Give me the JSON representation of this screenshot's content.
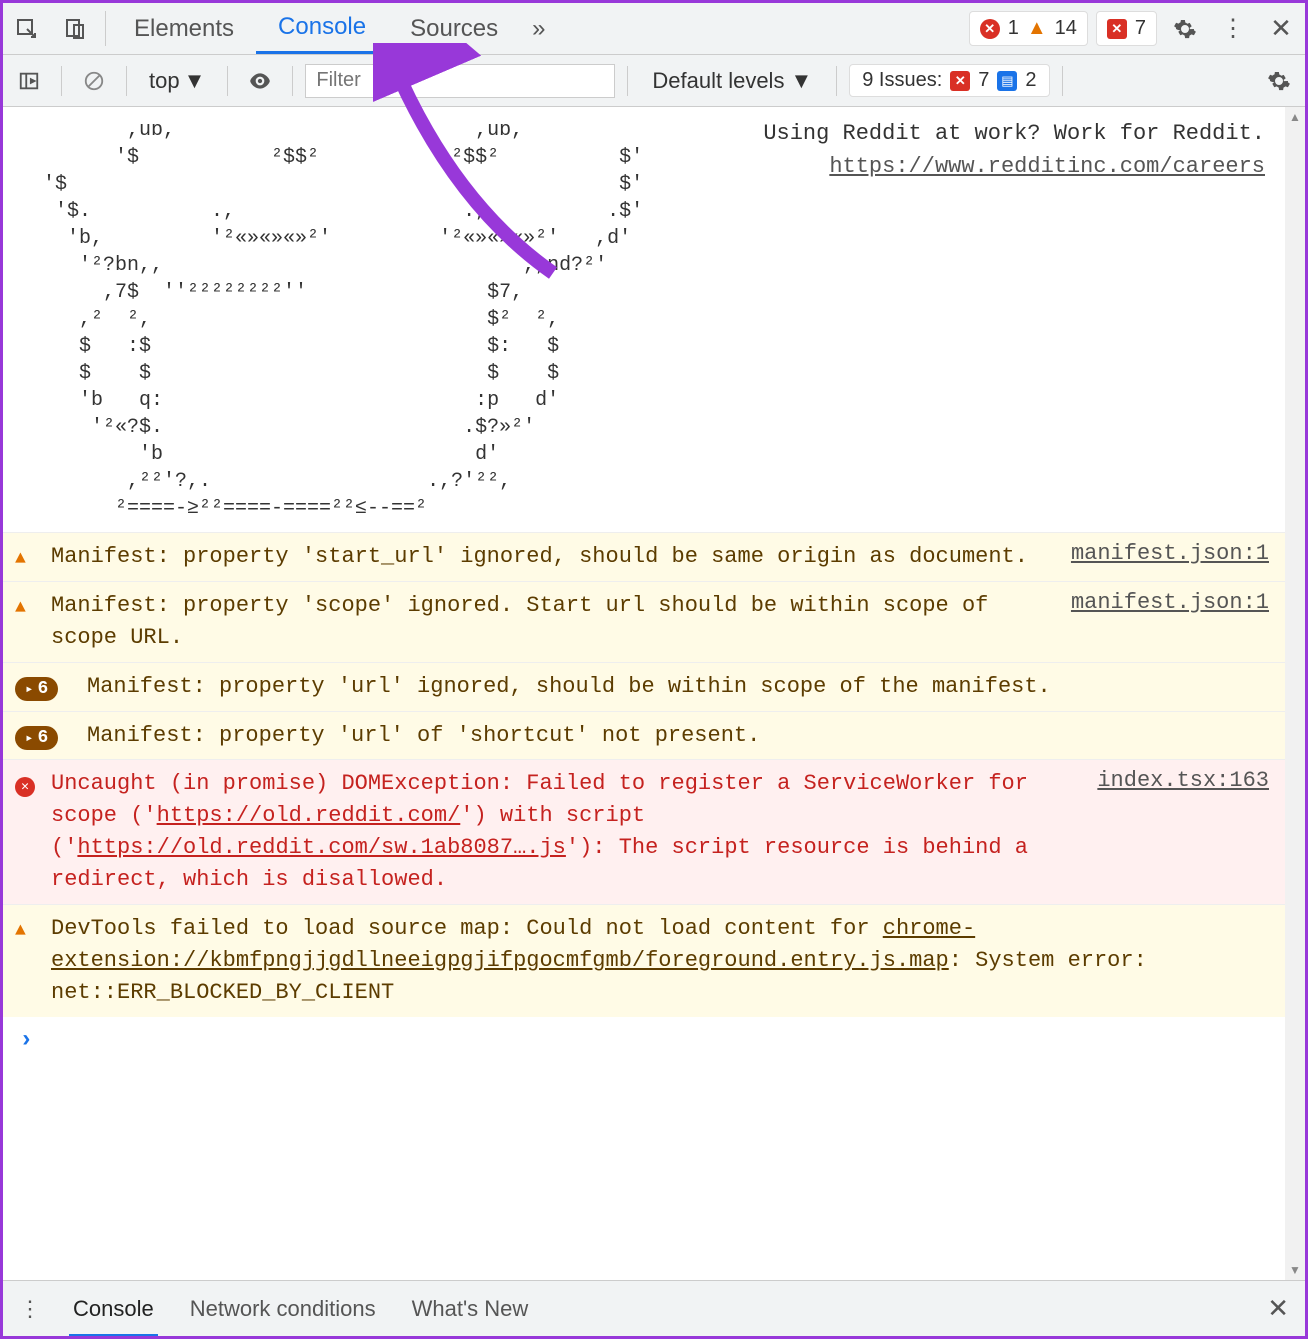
{
  "tabs": {
    "elements": "Elements",
    "console": "Console",
    "sources": "Sources"
  },
  "counts": {
    "errors": "1",
    "warnings": "14",
    "messages": "7"
  },
  "toolbar": {
    "context": "top",
    "filter_placeholder": "Filter",
    "levels": "Default levels",
    "issues_label": "9 Issues:",
    "issues_err": "7",
    "issues_info": "2"
  },
  "ascii": {
    "art": "       ,uɒ,                         ,uɒ,\n      '$           ²$$²           ²$$²          $'\n'$                                              $'\n '$.          .,                   .,          .$'\n  'b,         '²«»«»«»²'         '²«»«»«»²'   ,d'\n   '²?bn,,                              ,,nd?²'\n     ,7$  ''²²²²²²²²''               $7,\n   ,²  ²,                            $²  ²,\n   $   :$                            $:   $\n   $    $                            $    $\n   'b   q:                          :p   d'\n    '²«?$.                         .$?»²'\n        'b                          d'\n       ,²²'?,.                  .,?'²²,\n      ²====-≥²²====-====²²≤--==²",
    "msg_line1": "Using Reddit at work? Work for Reddit.",
    "msg_link": "https://www.redditinc.com/careers"
  },
  "messages": [
    {
      "type": "warn",
      "count": null,
      "text": "Manifest: property 'start_url' ignored, should be same origin as document.",
      "src": "manifest.json:1"
    },
    {
      "type": "warn",
      "count": null,
      "text": "Manifest: property 'scope' ignored. Start url should be within scope of scope URL.",
      "src": "manifest.json:1"
    },
    {
      "type": "warn",
      "count": "6",
      "text": "Manifest: property 'url' ignored, should be within scope of the manifest.",
      "src": null
    },
    {
      "type": "warn",
      "count": "6",
      "text": "Manifest: property 'url' of 'shortcut' not present.",
      "src": null
    },
    {
      "type": "err",
      "count": null,
      "text_pre": "Uncaught (in promise) DOMException: Failed to register a ServiceWorker for scope ('",
      "link1": "https://old.reddit.com/",
      "text_mid": "') with script ('",
      "link2": "https://old.reddit.com/sw.1ab8087….js",
      "text_post": "'): The script resource is behind a redirect, which is disallowed.",
      "src": "index.tsx:163"
    },
    {
      "type": "warn",
      "count": null,
      "text_pre": "DevTools failed to load source map: Could not load content for ",
      "link1": "chrome-extension://kbmfpngjjgdllneeigpgjifpgocmfgmb/foreground.entry.js.map",
      "text_post": ": System error: net::ERR_BLOCKED_BY_CLIENT",
      "src": null
    }
  ],
  "drawer": {
    "console": "Console",
    "network": "Network conditions",
    "whatsnew": "What's New"
  }
}
